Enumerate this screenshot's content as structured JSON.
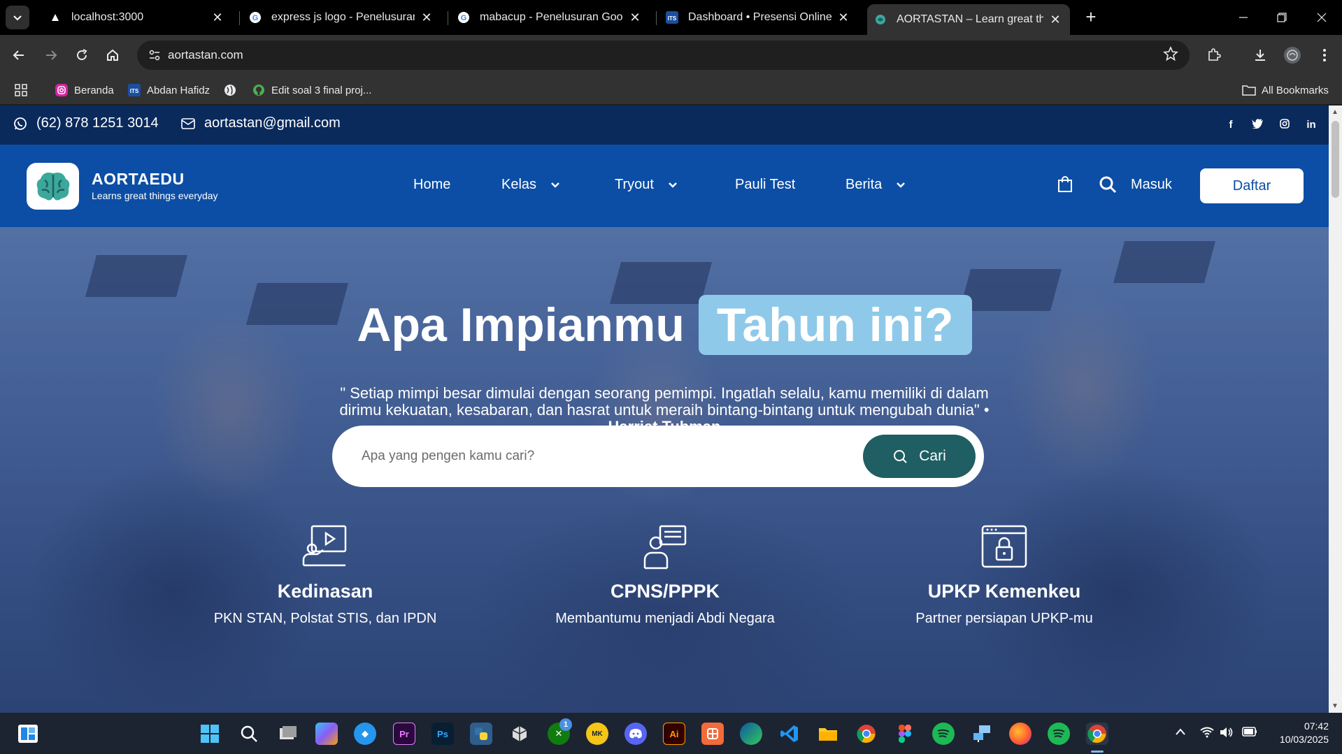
{
  "browser": {
    "tabs": [
      {
        "title": "localhost:3000"
      },
      {
        "title": "express js logo - Penelusuran G"
      },
      {
        "title": "mabacup - Penelusuran Google"
      },
      {
        "title": "Dashboard • Presensi Online ITS"
      },
      {
        "title": "AORTASTAN – Learn great things"
      }
    ],
    "url": "aortastan.com",
    "bookmarks": [
      {
        "label": "Beranda"
      },
      {
        "label": "Abdan Hafidz"
      },
      {
        "label": ""
      },
      {
        "label": "Edit soal 3 final proj..."
      }
    ],
    "all_bookmarks": "All Bookmarks"
  },
  "site": {
    "topbar": {
      "phone": "(62) 878 1251 3014",
      "email": "aortastan@gmail.com",
      "social": [
        "facebook-icon",
        "twitter-icon",
        "instagram-icon",
        "linkedin-icon"
      ]
    },
    "brand": {
      "name": "AORTAEDU",
      "tagline": "Learns great things everyday"
    },
    "nav": {
      "home": "Home",
      "kelas": "Kelas",
      "tryout": "Tryout",
      "pauli": "Pauli Test",
      "berita": "Berita",
      "masuk": "Masuk",
      "daftar": "Daftar"
    },
    "hero": {
      "headline_main": "Apa Impianmu",
      "headline_highlight": "Tahun ini?",
      "quote": "\" Setiap mimpi besar dimulai dengan seorang pemimpi. Ingatlah selalu, kamu memiliki di dalam dirimu kekuatan, kesabaran, dan hasrat untuk meraih bintang-bintang untuk mengubah dunia\" • ",
      "quote_author": "Harriet Tubman",
      "search_placeholder": "Apa yang pengen kamu cari?",
      "search_button": "Cari"
    },
    "features": [
      {
        "title": "Kedinasan",
        "subtitle": "PKN STAN, Polstat STIS, dan IPDN"
      },
      {
        "title": "CPNS/PPPK",
        "subtitle": "Membantumu menjadi Abdi Negara"
      },
      {
        "title": "UPKP Kemenkeu",
        "subtitle": "Partner persiapan UPKP-mu"
      }
    ]
  },
  "colors": {
    "topbar_bg": "#0a2a5c",
    "navbar_bg": "#0c4ea5",
    "highlight": "#8ec9ea",
    "search_button": "#1f5e63"
  },
  "taskbar": {
    "apps": [
      "windows-start-icon",
      "search-icon",
      "file-explorer-icon",
      "copilot-icon",
      "docker-icon",
      "premiere-icon",
      "photoshop-icon",
      "python-icon",
      "unity-icon",
      "xbox-icon",
      "mk-icon",
      "discord-icon",
      "illustrator-icon",
      "postman-icon",
      "edge-icon",
      "vscode-icon",
      "folder-icon",
      "chrome-icon",
      "figma-icon",
      "spotify-icon",
      "network-app-icon",
      "firefox-icon",
      "spotify-icon",
      "chrome-icon"
    ],
    "xbox_badge": "1",
    "time": "07:42",
    "date": "10/03/2025"
  }
}
